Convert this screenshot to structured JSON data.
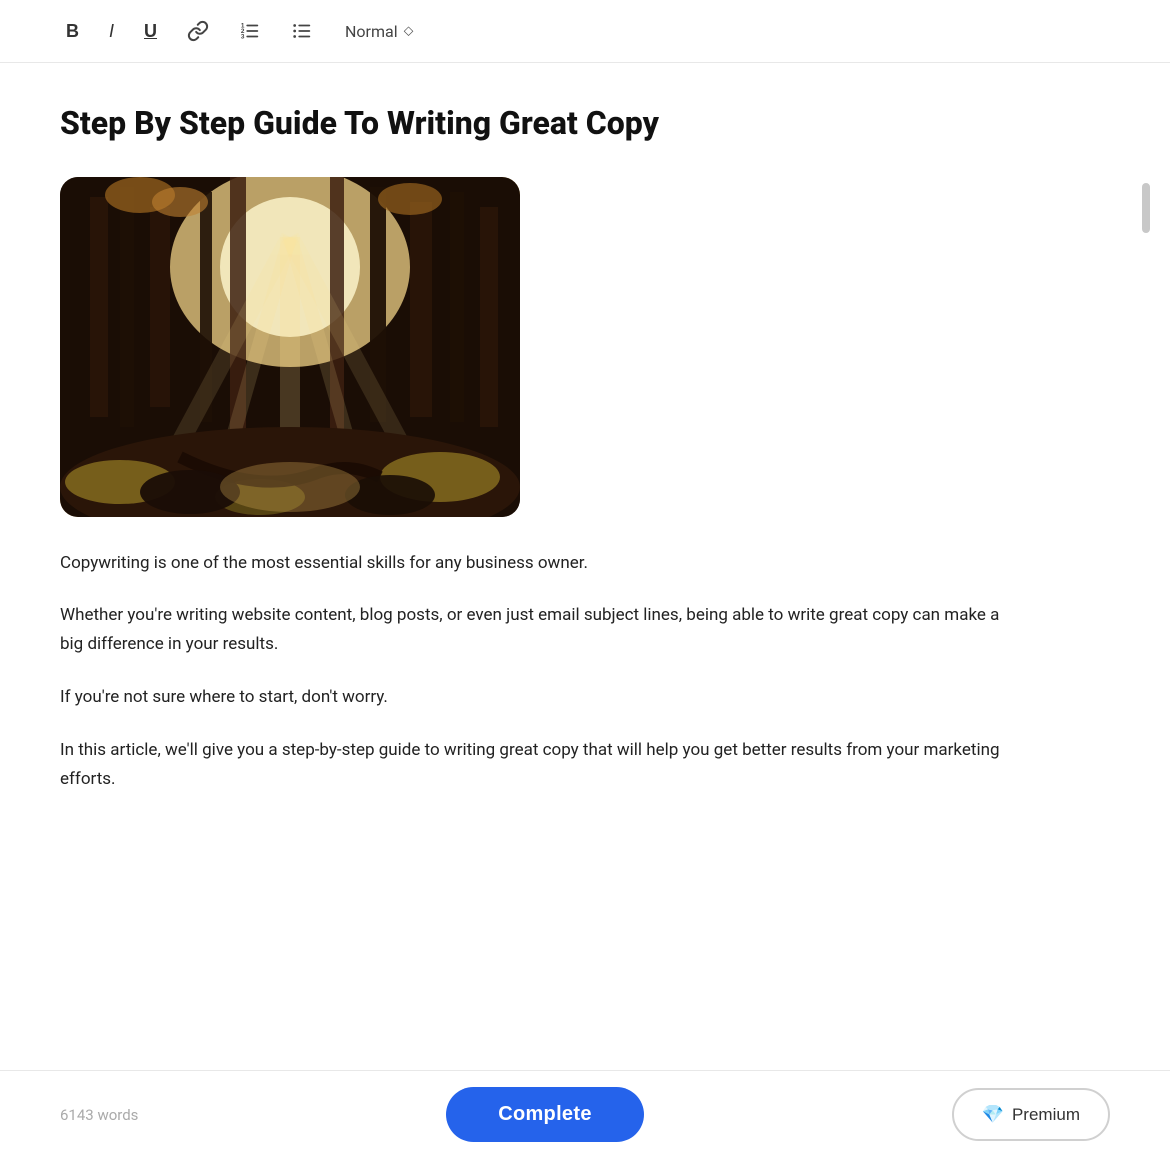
{
  "toolbar": {
    "bold_label": "B",
    "italic_label": "I",
    "underline_label": "U",
    "link_label": "🔗",
    "ordered_list_label": "≡",
    "unordered_list_label": "☰",
    "style_select_label": "Normal",
    "style_chevron": "⬦"
  },
  "article": {
    "title": "Step By Step Guide To Writing Great Copy",
    "paragraphs": [
      "Copywriting is one of the most essential skills for any business owner.",
      "Whether you're writing website content, blog posts, or even just email subject lines, being able to write great copy can make a big difference in your results.",
      "If you're not sure where to start, don't worry.",
      "In this article, we'll give you a step-by-step guide to writing great copy that will help you get better results from your marketing efforts."
    ]
  },
  "bottom_bar": {
    "word_count": "6143 words",
    "complete_label": "Complete",
    "premium_label": "Premium",
    "diamond_icon": "💎"
  }
}
